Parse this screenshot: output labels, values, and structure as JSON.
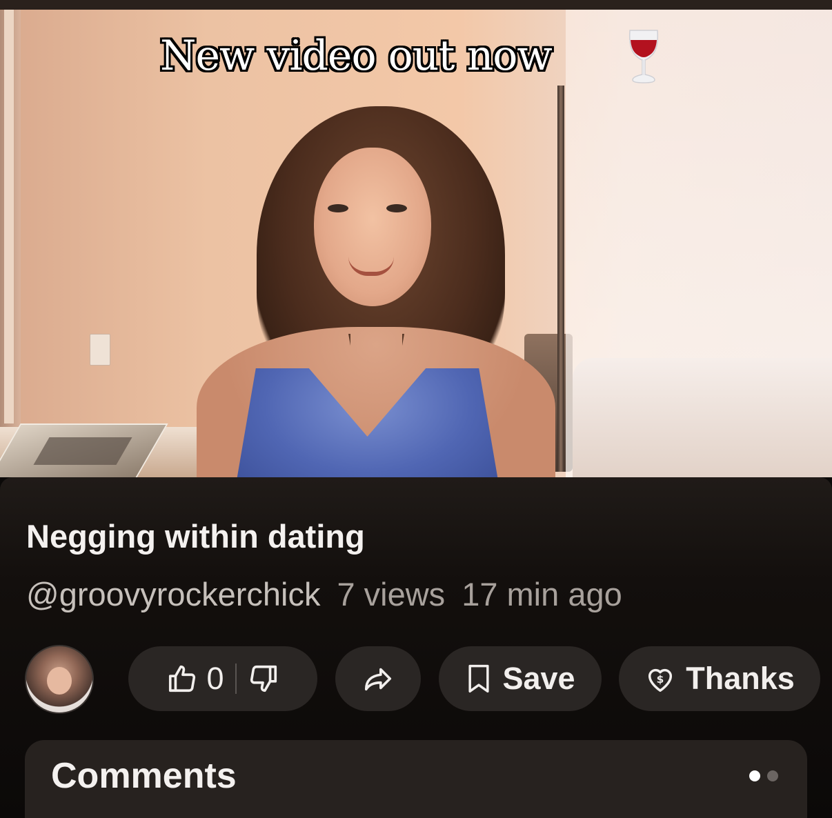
{
  "video": {
    "caption": "New video out now",
    "caption_emoji": "wine-glass-icon"
  },
  "video_info": {
    "title": "Negging within dating",
    "channel_handle": "@groovyrockerchick",
    "views": "7 views",
    "posted": "17 min ago"
  },
  "actions": {
    "like_count": "0",
    "save_label": "Save",
    "thanks_label": "Thanks"
  },
  "comments": {
    "title": "Comments",
    "page_dots": 2,
    "active_dot": 1
  },
  "colors": {
    "background": "#0b0908",
    "pill_bg": "#2a2624",
    "comments_bg": "#27221f",
    "text_primary": "#f4f1ef",
    "text_secondary": "#a8a19c"
  }
}
